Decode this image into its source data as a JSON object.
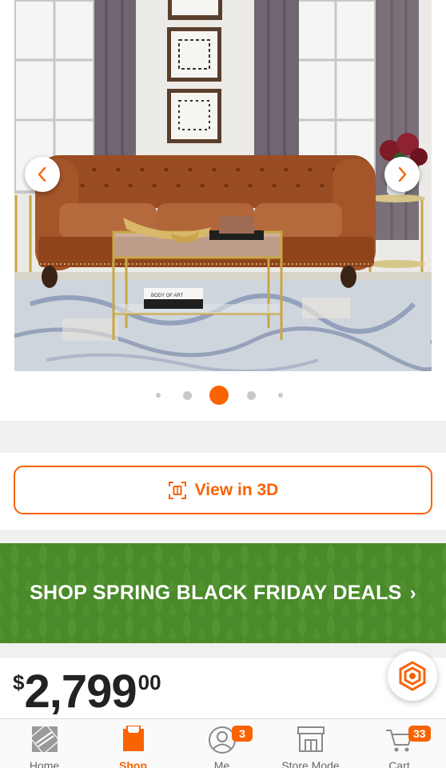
{
  "carousel": {
    "prev_icon": "chevron-left-icon",
    "next_icon": "chevron-right-icon",
    "book_title": "BODY OF ART",
    "dot_count": 5,
    "active_dot": 3
  },
  "view3d": {
    "label": "View in 3D",
    "icon": "3d-view-icon"
  },
  "banner": {
    "text": "SHOP SPRING BLACK FRIDAY DEALS",
    "chevron": "›"
  },
  "price": {
    "currency": "$",
    "dollars": "2,799",
    "cents": "00"
  },
  "help_icon": "help-hexagon-icon",
  "tabbar": {
    "tabs": [
      {
        "label": "Home",
        "icon": "home-depot-logo-icon"
      },
      {
        "label": "Shop",
        "icon": "shop-bag-icon",
        "active": true
      },
      {
        "label": "Me",
        "icon": "user-icon",
        "badge": "3"
      },
      {
        "label": "Store Mode",
        "icon": "store-icon"
      },
      {
        "label": "Cart",
        "icon": "cart-icon",
        "badge": "33"
      }
    ]
  },
  "colors": {
    "accent": "#f96302",
    "banner_green": "#4a8a2a",
    "section_gap": "#f0f0f0"
  }
}
